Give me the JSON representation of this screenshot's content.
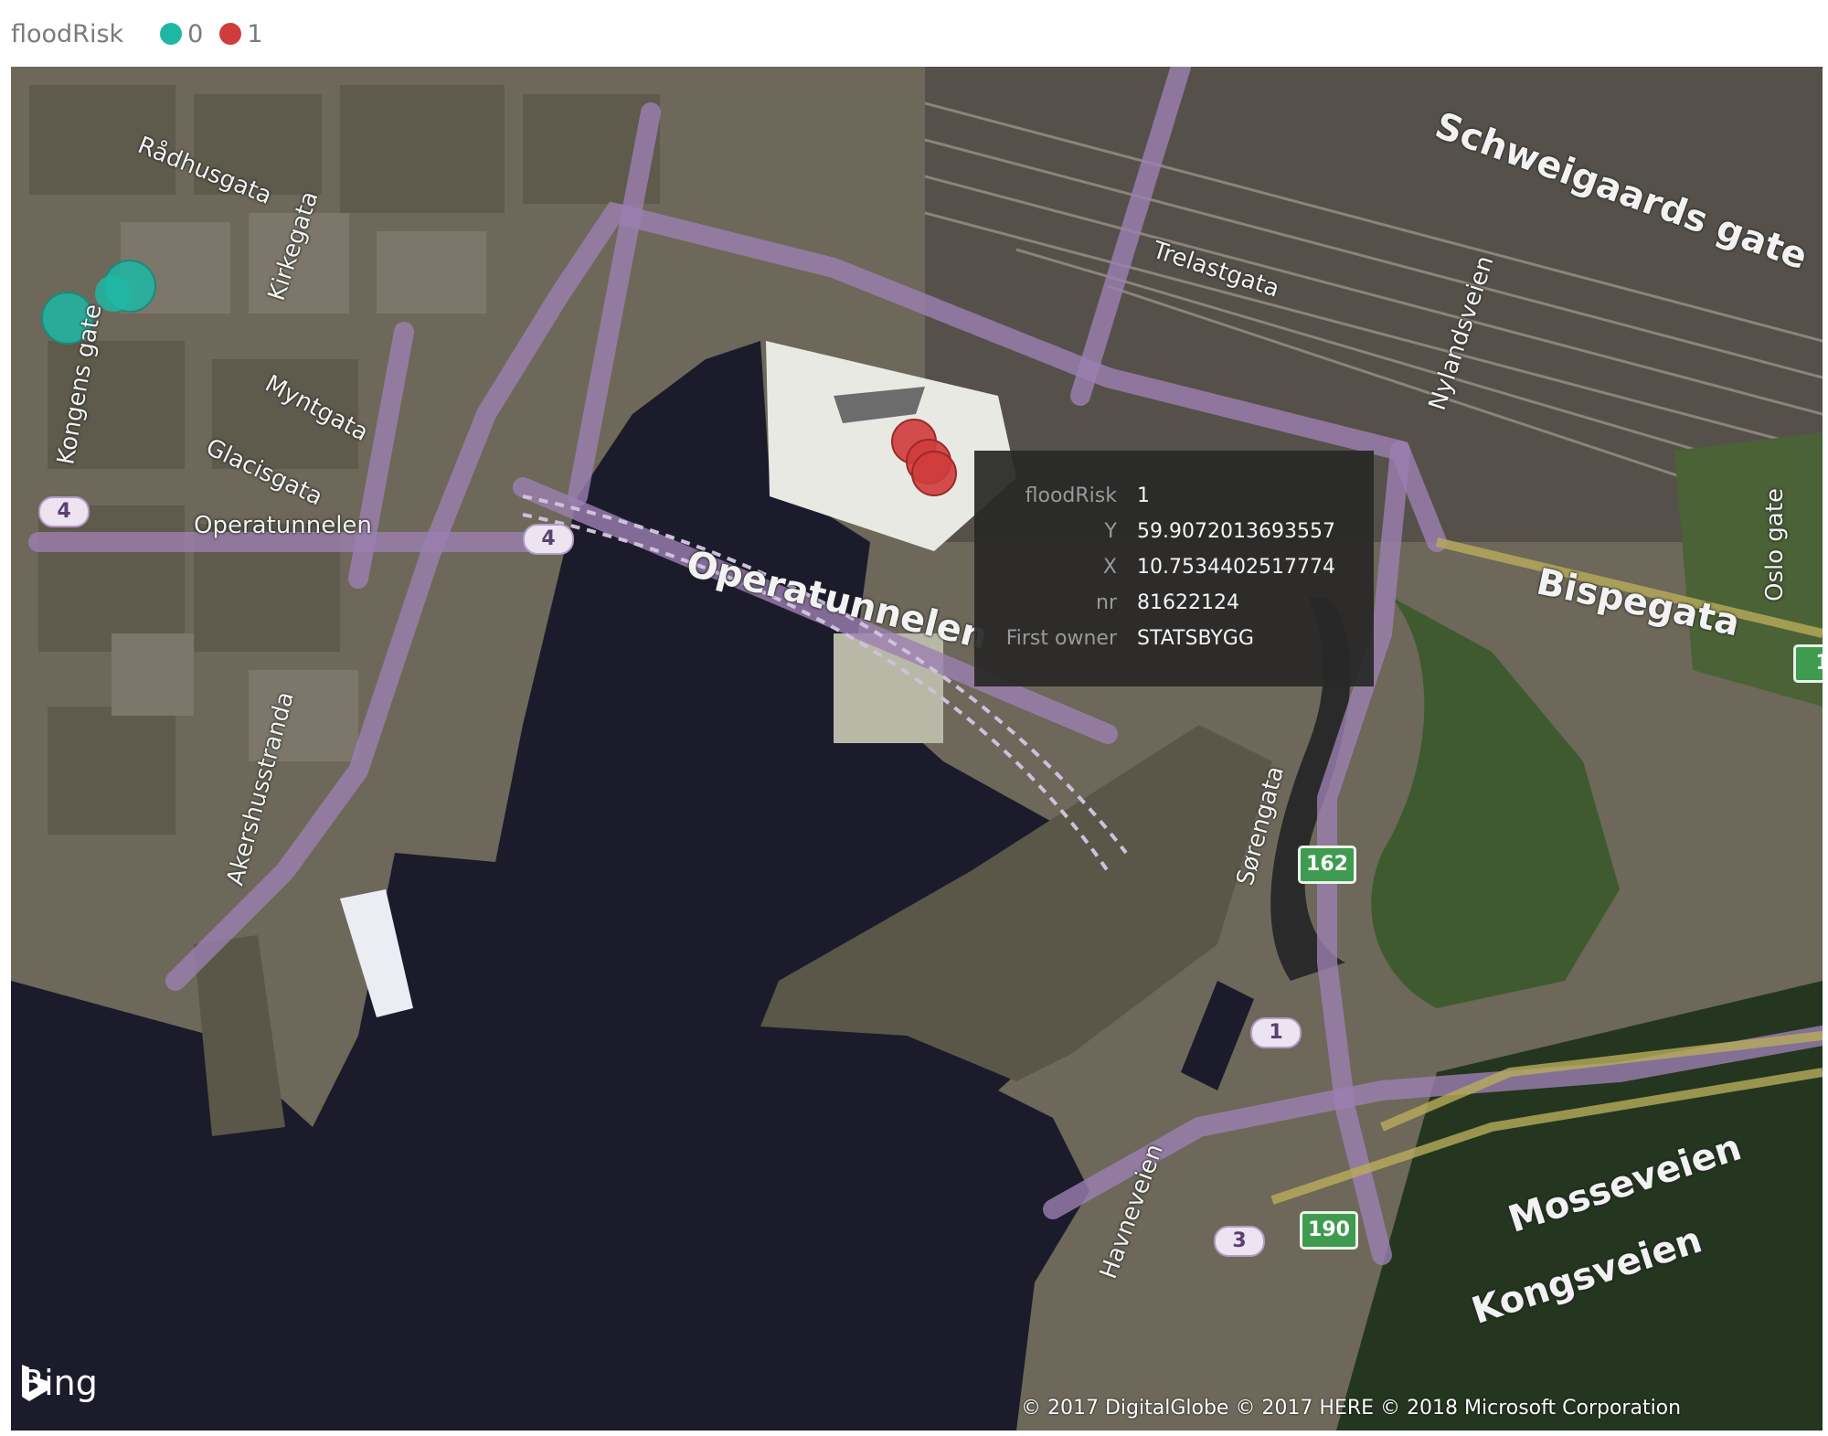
{
  "legend": {
    "title": "floodRisk",
    "entries": [
      {
        "label": "0",
        "color": "#1fb7a4"
      },
      {
        "label": "1",
        "color": "#d03b3b"
      }
    ]
  },
  "tooltip": {
    "rows": [
      {
        "key": "floodRisk",
        "value": "1"
      },
      {
        "key": "Y",
        "value": "59.9072013693557"
      },
      {
        "key": "X",
        "value": "10.7534402517774"
      },
      {
        "key": "nr",
        "value": "81622124"
      },
      {
        "key": "First owner",
        "value": "STATSBYGG"
      }
    ]
  },
  "map": {
    "streets": [
      "Rådhusgata",
      "Kirkegata",
      "Myntgata",
      "Glacisgata",
      "Kongens gate",
      "Operatunnelen",
      "Operatunnelen",
      "Trelastgata",
      "Schweigaards gate",
      "Nylandsveien",
      "Bispegata",
      "Oslo gate",
      "Sørengata",
      "Mosseveien",
      "Kongsveien",
      "Havneveien",
      "Akershusstranda"
    ],
    "shields": [
      "4",
      "4",
      "162",
      "1",
      "3",
      "190",
      "1"
    ]
  },
  "attribution": {
    "brand": "Bing",
    "copyright": "© 2017 DigitalGlobe © 2017 HERE © 2018 Microsoft Corporation"
  }
}
